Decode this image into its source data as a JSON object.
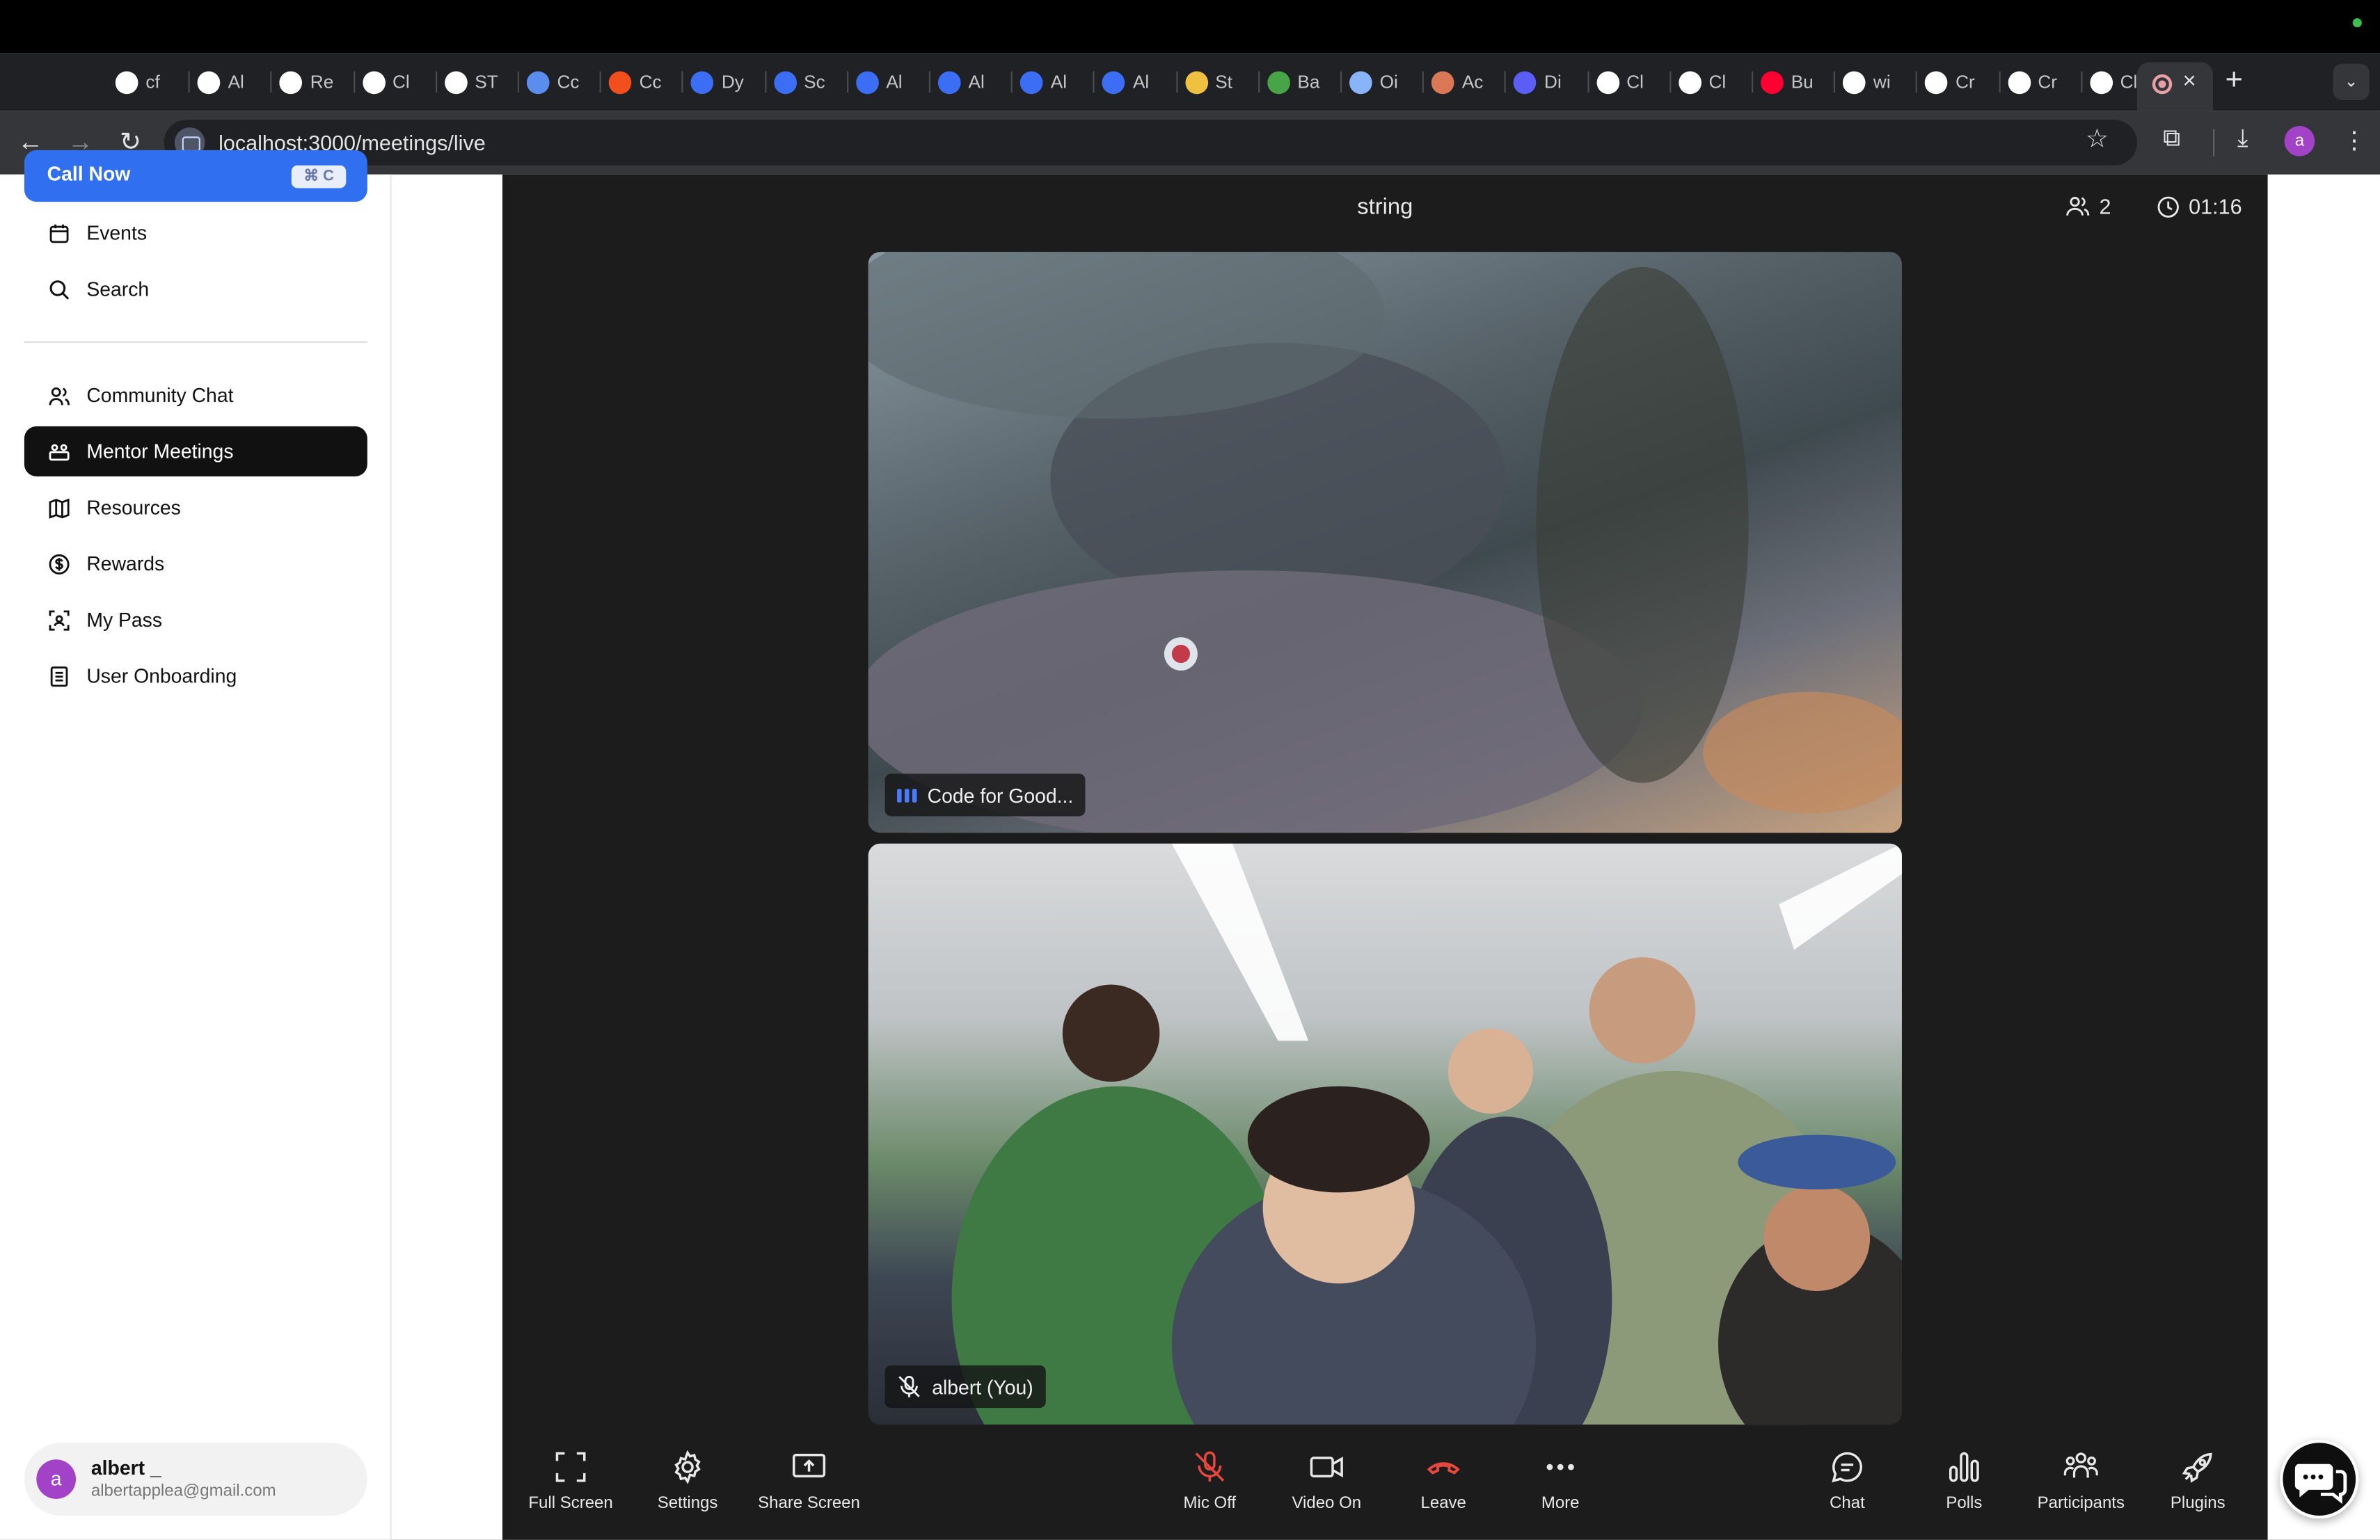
{
  "browser": {
    "url": "localhost:3000/meetings/live",
    "tabs": [
      {
        "label": "cf",
        "icon": "github-icon",
        "color": "#ffffff"
      },
      {
        "label": "Al",
        "icon": "wordpress-icon",
        "color": "#ffffff"
      },
      {
        "label": "Re",
        "icon": "wordpress-icon",
        "color": "#ffffff"
      },
      {
        "label": "Cl",
        "icon": "wordpress-icon",
        "color": "#ffffff"
      },
      {
        "label": "ST",
        "icon": "wordpress-icon",
        "color": "#ffffff"
      },
      {
        "label": "Cc",
        "icon": "docs-icon",
        "color": "#5a8dee"
      },
      {
        "label": "Cc",
        "icon": "figma-icon",
        "color": "#f24e1e"
      },
      {
        "label": "Dy",
        "icon": "app-icon",
        "color": "#3b6ef5"
      },
      {
        "label": "Sc",
        "icon": "app-icon",
        "color": "#3b6ef5"
      },
      {
        "label": "Al",
        "icon": "app-icon",
        "color": "#3b6ef5"
      },
      {
        "label": "Al",
        "icon": "app-icon",
        "color": "#3b6ef5"
      },
      {
        "label": "Al",
        "icon": "app-icon",
        "color": "#3b6ef5"
      },
      {
        "label": "Al",
        "icon": "app-icon",
        "color": "#3b6ef5"
      },
      {
        "label": "St",
        "icon": "swirl-icon",
        "color": "#f0c040"
      },
      {
        "label": "Ba",
        "icon": "b64-icon",
        "color": "#47a547"
      },
      {
        "label": "Oi",
        "icon": "globe-icon",
        "color": "#8ab4f8"
      },
      {
        "label": "Ac",
        "icon": "asterisk-icon",
        "color": "#d97757"
      },
      {
        "label": "Di",
        "icon": "c-icon",
        "color": "#5b5ef5"
      },
      {
        "label": "Cl",
        "icon": "openai-icon",
        "color": "#ffffff"
      },
      {
        "label": "Cl",
        "icon": "triangle-icon",
        "color": "#ffffff"
      },
      {
        "label": "Bu",
        "icon": "youtube-icon",
        "color": "#ff0033"
      },
      {
        "label": "wi",
        "icon": "github-icon",
        "color": "#ffffff"
      },
      {
        "label": "Cr",
        "icon": "triangle-icon",
        "color": "#ffffff"
      },
      {
        "label": "Cr",
        "icon": "triangle-icon",
        "color": "#ffffff"
      },
      {
        "label": "Cl",
        "icon": "triangle-icon",
        "color": "#ffffff"
      }
    ],
    "active_tab_close": "×",
    "new_tab": "+",
    "profile_initial": "a"
  },
  "sidebar": {
    "call_now": {
      "label": "Call Now",
      "shortcut": "⌘ C"
    },
    "items_top": [
      {
        "label": "Events",
        "icon": "calendar-icon"
      },
      {
        "label": "Search",
        "icon": "search-icon"
      }
    ],
    "items": [
      {
        "label": "Community Chat",
        "icon": "users-icon",
        "active": false
      },
      {
        "label": "Mentor Meetings",
        "icon": "meeting-icon",
        "active": true
      },
      {
        "label": "Resources",
        "icon": "map-icon",
        "active": false
      },
      {
        "label": "Rewards",
        "icon": "dollar-icon",
        "active": false
      },
      {
        "label": "My Pass",
        "icon": "scan-icon",
        "active": false
      },
      {
        "label": "User Onboarding",
        "icon": "document-icon",
        "active": false
      }
    ],
    "user": {
      "initial": "a",
      "name": "albert _",
      "email": "albertapplea@gmail.com"
    }
  },
  "meeting": {
    "title": "string",
    "participant_count": "2",
    "timer": "01:16",
    "tiles": [
      {
        "label": "Code for Good...",
        "speaking": true
      },
      {
        "label": "albert (You)",
        "muted": true
      }
    ],
    "controls_left": [
      {
        "label": "Full Screen",
        "icon": "fullscreen-icon"
      },
      {
        "label": "Settings",
        "icon": "gear-icon"
      },
      {
        "label": "Share Screen",
        "icon": "share-screen-icon"
      }
    ],
    "controls_center": [
      {
        "label": "Mic Off",
        "icon": "mic-off-icon"
      },
      {
        "label": "Video On",
        "icon": "video-icon"
      },
      {
        "label": "Leave",
        "icon": "phone-hangup-icon"
      },
      {
        "label": "More",
        "icon": "more-icon"
      }
    ],
    "controls_right": [
      {
        "label": "Chat",
        "icon": "chat-icon"
      },
      {
        "label": "Polls",
        "icon": "polls-icon"
      },
      {
        "label": "Participants",
        "icon": "participants-icon"
      },
      {
        "label": "Plugins",
        "icon": "rocket-icon"
      }
    ],
    "accent": "#e5483f"
  }
}
